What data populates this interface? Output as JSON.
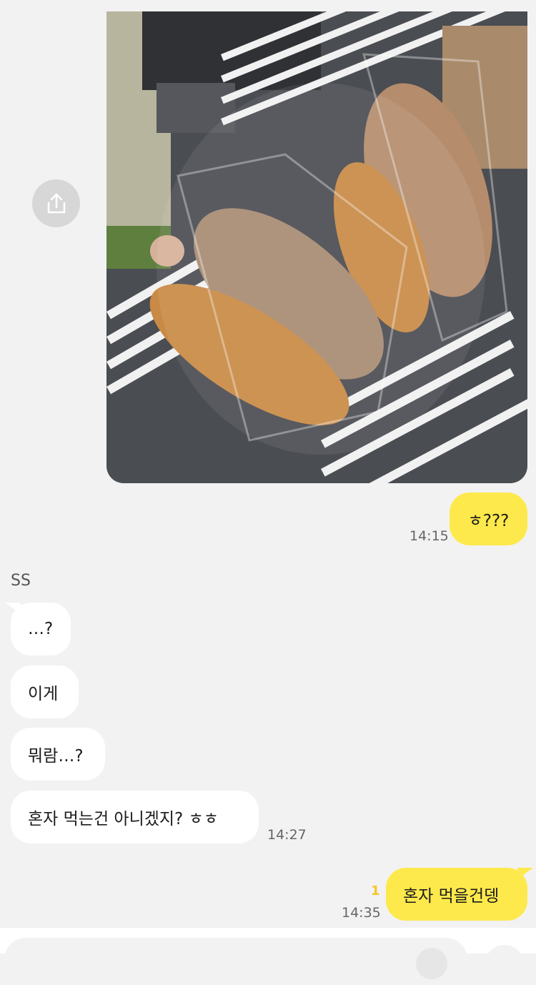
{
  "chat": {
    "sender_name": "SS",
    "messages": [
      {
        "from": "me",
        "text": "ㅎ???",
        "time": "14:15"
      },
      {
        "from": "them",
        "text": "…?"
      },
      {
        "from": "them",
        "text": "이게"
      },
      {
        "from": "them",
        "text": "뭐람…?"
      },
      {
        "from": "them",
        "text": "혼자 먹는건 아니겠지? ㅎㅎ",
        "time": "14:27"
      },
      {
        "from": "me",
        "text": "혼자 먹을건뎅",
        "time": "14:35",
        "unread": "1"
      }
    ]
  },
  "colors": {
    "background": "#f2f2f2",
    "my_bubble": "#fde94c",
    "their_bubble": "#ffffff",
    "unread": "#f3c623"
  },
  "icons": {
    "share": "share-icon"
  }
}
